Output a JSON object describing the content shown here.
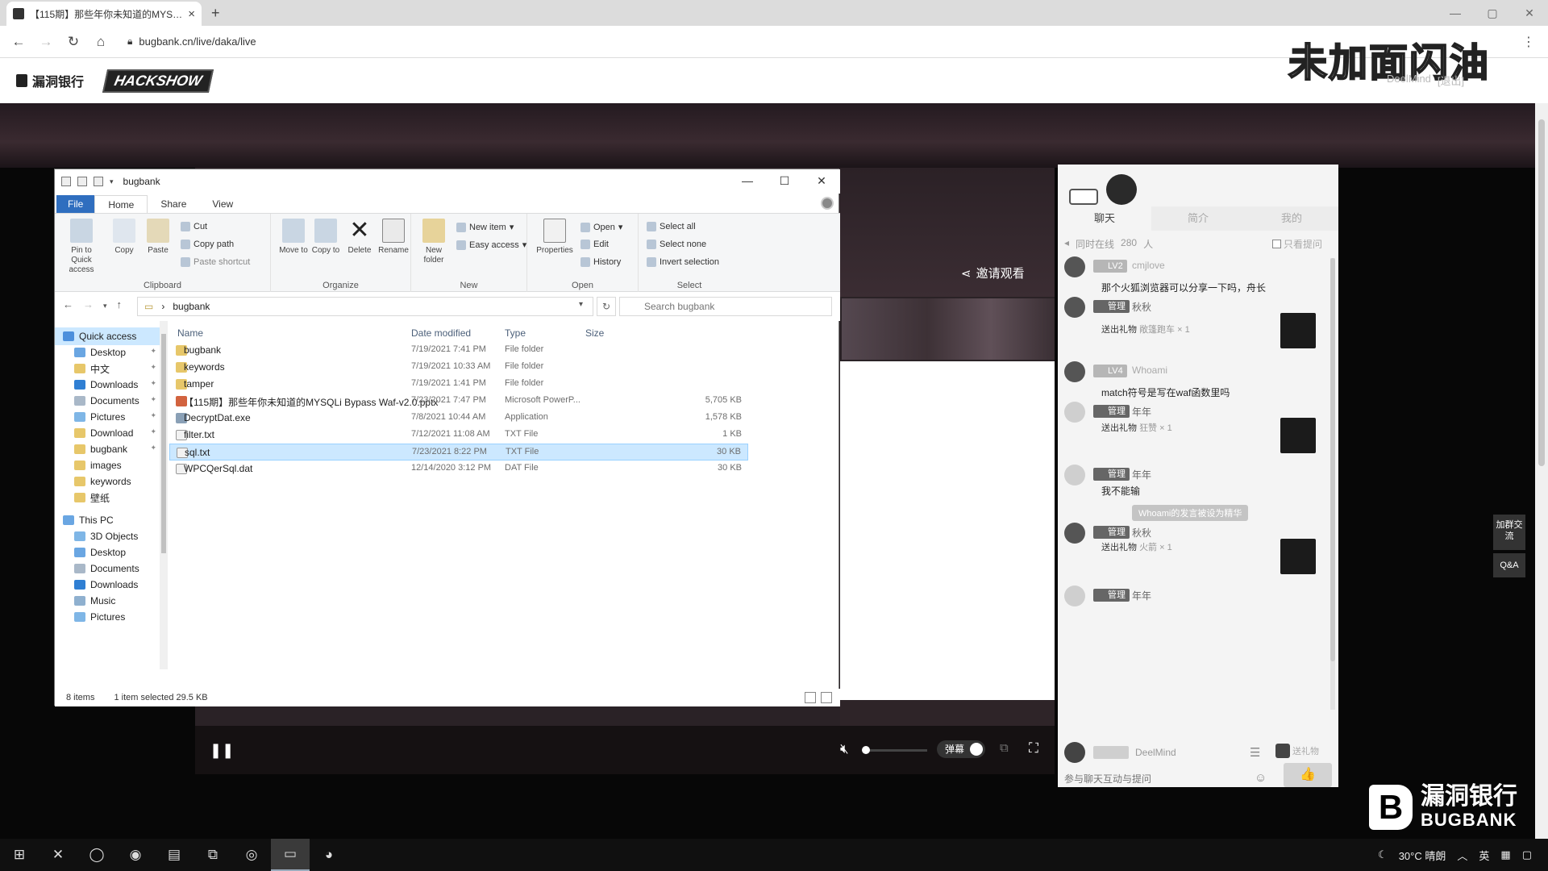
{
  "browser": {
    "tab_title": "【115期】那些年你未知道的MYSQL",
    "tab_close": "×",
    "new_tab": "+",
    "url": "bugbank.cn/live/daka/live",
    "window_controls": [
      "—",
      "▢",
      "✕"
    ]
  },
  "site": {
    "logo_text": "漏洞银行",
    "show_logo": "HACKSHOW",
    "user_name": "DeelMind",
    "logout": "[退出]",
    "watermark_top": "未加面闪油"
  },
  "stage": {
    "invite_label": "邀请观看",
    "danmu_label": "弹幕",
    "volume_level": 0.05
  },
  "chat": {
    "tabs": [
      "聊天",
      "简介",
      "我的"
    ],
    "online_label": "同时在线",
    "online_count": "280",
    "online_unit": "人",
    "only_questions": "只看提问",
    "messages": [
      {
        "badge": "LV2",
        "nick": "cmjlove",
        "text": "那个火狐浏览器可以分享一下吗，舟长"
      },
      {
        "badge": "管理",
        "nick": "秋秋",
        "gift_prefix": "送出礼物",
        "gift_name": "敞篷跑车",
        "gift_count": "× 1"
      },
      {
        "badge": "LV4",
        "nick": "Whoami",
        "text": "match符号是写在waf函数里吗"
      },
      {
        "badge": "管理",
        "nick": "年年",
        "gift_prefix": "送出礼物",
        "gift_name": "狂赞",
        "gift_count": "× 1"
      },
      {
        "badge": "管理",
        "nick": "年年",
        "text": "我不能输"
      },
      {
        "badge": "管理",
        "nick": "秋秋",
        "gift_prefix": "送出礼物",
        "gift_name": "火箭",
        "gift_count": "× 1"
      },
      {
        "badge": "管理",
        "nick": "年年"
      }
    ],
    "system_notice": "Whoami的发言被设为精华",
    "self_nick": "DeelMind",
    "gift_button": "送礼物",
    "input_placeholder": "参与聊天互动与提问",
    "send_icon": "👍"
  },
  "floating": {
    "join_group": "加群交流",
    "qa": "Q&A"
  },
  "brand": {
    "mark": "B",
    "cn": "漏洞银行",
    "en": "BUGBANK"
  },
  "explorer": {
    "title": "bugbank",
    "window_controls": [
      "—",
      "☐",
      "✕"
    ],
    "menu": [
      "File",
      "Home",
      "Share",
      "View"
    ],
    "ribbon": {
      "clipboard": {
        "label": "Clipboard",
        "pin": "Pin to Quick access",
        "copy": "Copy",
        "paste": "Paste",
        "cut": "Cut",
        "copy_path": "Copy path",
        "paste_shortcut": "Paste shortcut"
      },
      "organize": {
        "label": "Organize",
        "move_to": "Move to",
        "copy_to": "Copy to",
        "delete": "Delete",
        "rename": "Rename"
      },
      "new": {
        "label": "New",
        "new_folder": "New folder",
        "new_item": "New item",
        "easy_access": "Easy access"
      },
      "open": {
        "label": "Open",
        "properties": "Properties",
        "open": "Open",
        "edit": "Edit",
        "history": "History"
      },
      "select": {
        "label": "Select",
        "select_all": "Select all",
        "select_none": "Select none",
        "invert": "Invert selection"
      }
    },
    "address": "bugbank",
    "search_placeholder": "Search bugbank",
    "nav": {
      "quick_access": "Quick access",
      "quick_items": [
        "Desktop",
        "中文",
        "Downloads",
        "Documents",
        "Pictures",
        "Download",
        "bugbank",
        "images",
        "keywords",
        "壁纸"
      ],
      "this_pc": "This PC",
      "pc_items": [
        "3D Objects",
        "Desktop",
        "Documents",
        "Downloads",
        "Music",
        "Pictures"
      ]
    },
    "columns": {
      "name": "Name",
      "date": "Date modified",
      "type": "Type",
      "size": "Size"
    },
    "files": [
      {
        "name": "bugbank",
        "date": "7/19/2021 7:41 PM",
        "type": "File folder",
        "size": "",
        "kind": "folder"
      },
      {
        "name": "keywords",
        "date": "7/19/2021 10:33 AM",
        "type": "File folder",
        "size": "",
        "kind": "folder"
      },
      {
        "name": "tamper",
        "date": "7/19/2021 1:41 PM",
        "type": "File folder",
        "size": "",
        "kind": "folder"
      },
      {
        "name": "【115期】那些年你未知道的MYSQLi Bypass Waf-v2.0.pptx",
        "date": "7/23/2021 7:47 PM",
        "type": "Microsoft PowerP...",
        "size": "5,705 KB",
        "kind": "pptx"
      },
      {
        "name": "DecryptDat.exe",
        "date": "7/8/2021 10:44 AM",
        "type": "Application",
        "size": "1,578 KB",
        "kind": "exe"
      },
      {
        "name": "filter.txt",
        "date": "7/12/2021 11:08 AM",
        "type": "TXT File",
        "size": "1 KB",
        "kind": "txt"
      },
      {
        "name": "sql.txt",
        "date": "7/23/2021 8:22 PM",
        "type": "TXT File",
        "size": "30 KB",
        "kind": "txt",
        "selected": true
      },
      {
        "name": "WPCQerSql.dat",
        "date": "12/14/2020 3:12 PM",
        "type": "DAT File",
        "size": "30 KB",
        "kind": "dat"
      }
    ],
    "status_count": "8 items",
    "status_selected": "1 item selected  29.5 KB"
  },
  "taskbar": {
    "weather": "30°C 晴朗",
    "ime": "英",
    "up_arrow": "︿"
  }
}
